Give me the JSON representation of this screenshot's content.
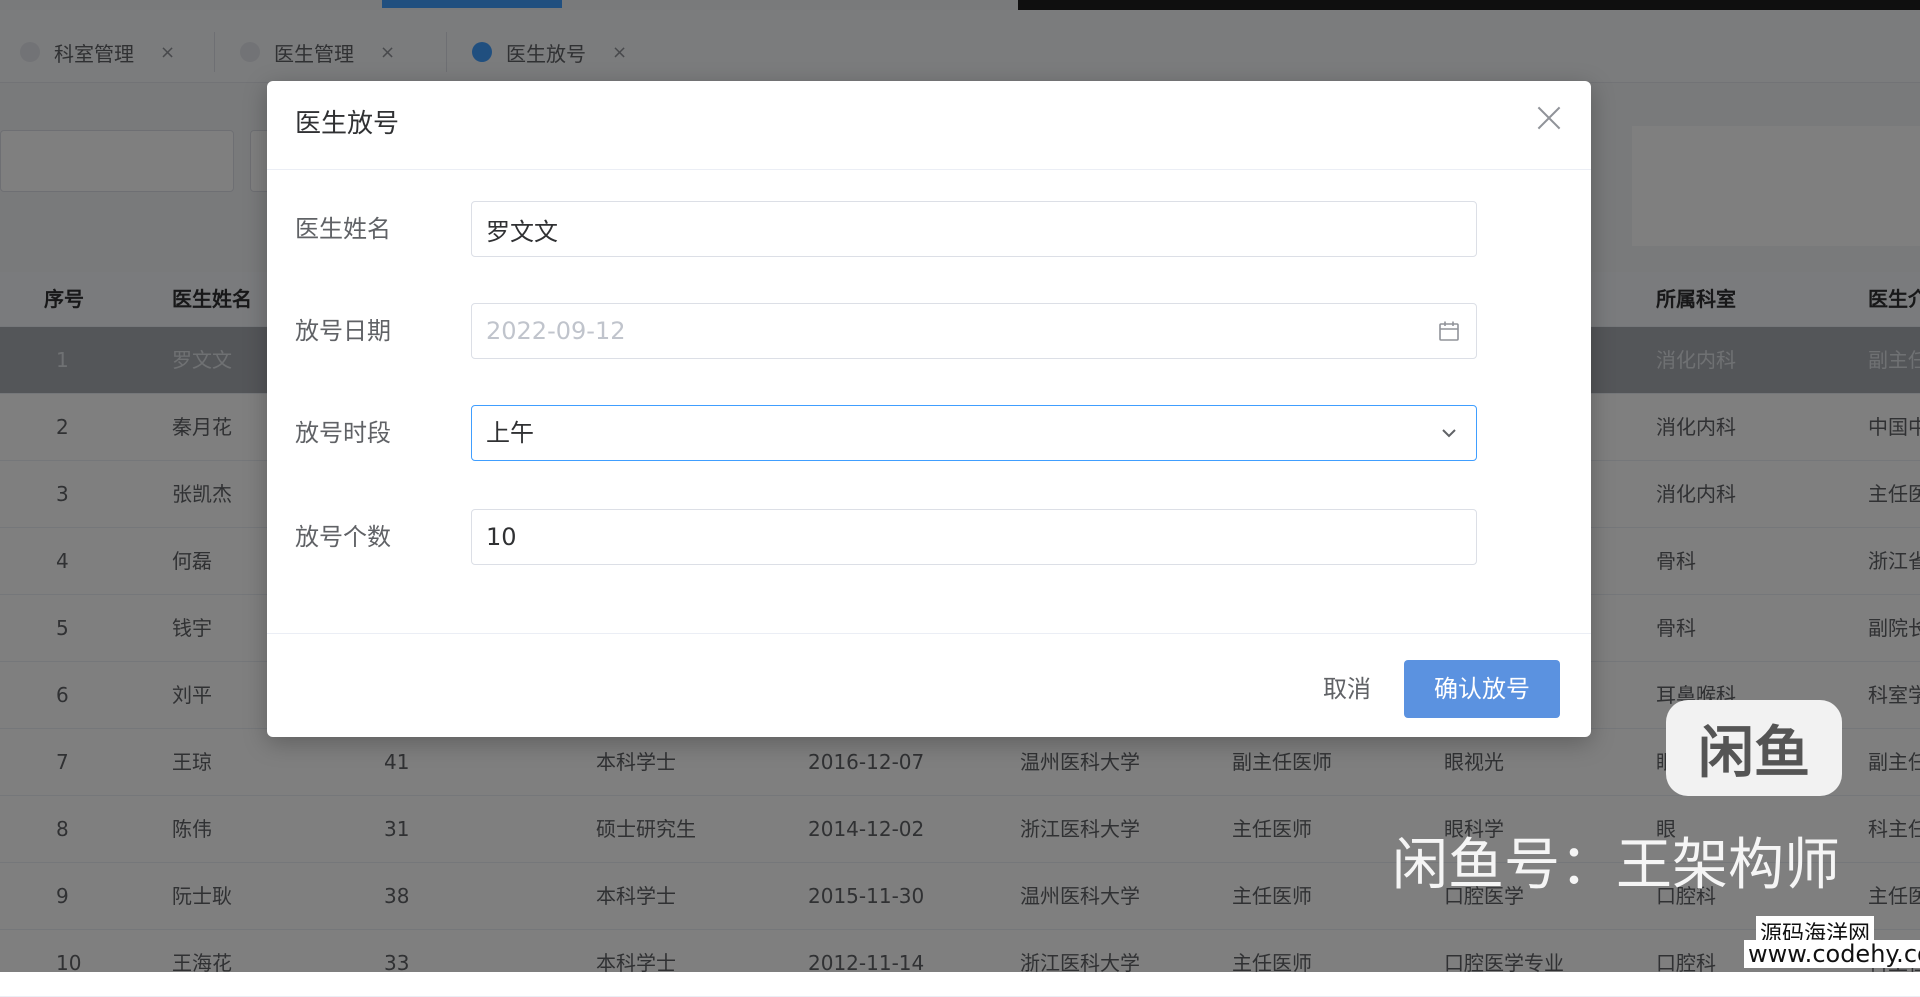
{
  "tabs": [
    {
      "label": "科室管理",
      "close": "×",
      "active": false
    },
    {
      "label": "医生管理",
      "close": "×",
      "active": false
    },
    {
      "label": "医生放号",
      "close": "×",
      "active": true
    }
  ],
  "table": {
    "columns": [
      "序号",
      "医生姓名",
      "",
      "",
      "",
      "",
      "",
      "",
      "所属科室",
      "医生介"
    ],
    "rows": [
      [
        "1",
        "罗文文",
        "",
        "",
        "",
        "",
        "",
        "",
        "消化内科",
        "副主任"
      ],
      [
        "2",
        "秦月花",
        "",
        "",
        "",
        "",
        "",
        "",
        "消化内科",
        "中国中"
      ],
      [
        "3",
        "张凯杰",
        "",
        "",
        "",
        "",
        "",
        "",
        "消化内科",
        "主任医"
      ],
      [
        "4",
        "何磊",
        "",
        "",
        "",
        "",
        "",
        "",
        "骨科",
        "浙江省"
      ],
      [
        "5",
        "钱宇",
        "",
        "",
        "",
        "",
        "",
        "",
        "骨科",
        "副院长"
      ],
      [
        "6",
        "刘平",
        "",
        "",
        "",
        "",
        "",
        "",
        "耳鼻喉科",
        "科室学"
      ],
      [
        "7",
        "王琼",
        "41",
        "本科学士",
        "2016-12-07",
        "温州医科大学",
        "副主任医师",
        "眼视光",
        "眼",
        "副主任"
      ],
      [
        "8",
        "陈伟",
        "31",
        "硕士研究生",
        "2014-12-02",
        "浙江医科大学",
        "主任医师",
        "眼科学",
        "眼",
        "科主任"
      ],
      [
        "9",
        "阮士耿",
        "38",
        "本科学士",
        "2015-11-30",
        "温州医科大学",
        "主任医师",
        "口腔医学",
        "口腔科",
        "主任医"
      ],
      [
        "10",
        "王海花",
        "33",
        "本科学士",
        "2012-11-14",
        "浙江医科大学",
        "主任医师",
        "口腔医学专业",
        "口腔科",
        "科主任"
      ]
    ]
  },
  "dialog": {
    "title": "医生放号",
    "fields": {
      "name_label": "医生姓名",
      "name_value": "罗文文",
      "date_label": "放号日期",
      "date_value": "2022-09-12",
      "period_label": "放号时段",
      "period_value": "上午",
      "count_label": "放号个数",
      "count_value": "10"
    },
    "cancel_label": "取消",
    "confirm_label": "确认放号"
  },
  "watermark": {
    "logo": "闲鱼",
    "text": "闲鱼号：王架构师",
    "site_name": "源码海洋网",
    "site_url": "www.codehy.com"
  },
  "colors": {
    "primary": "#409eff",
    "confirm_button": "#5b92e0",
    "mask": "rgba(0,0,0,0.5)"
  },
  "icons": [
    "close-icon",
    "calendar-icon",
    "chevron-down-icon"
  ]
}
